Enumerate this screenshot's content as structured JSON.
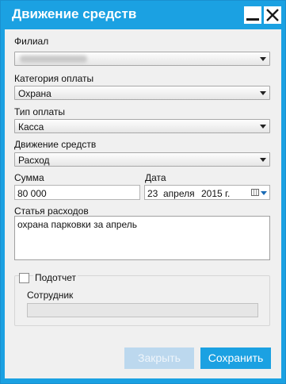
{
  "window": {
    "title": "Движение средств"
  },
  "fields": {
    "branch": {
      "label": "Филиал",
      "value": ""
    },
    "payment_category": {
      "label": "Категория оплаты",
      "value": "Охрана"
    },
    "payment_type": {
      "label": "Тип оплаты",
      "value": "Касса"
    },
    "cash_flow": {
      "label": "Движение средств",
      "value": "Расход"
    },
    "amount": {
      "label": "Сумма",
      "value": "80 000"
    },
    "date": {
      "label": "Дата",
      "day": "23",
      "month": "апреля",
      "year": "2015 г."
    },
    "expense_item": {
      "label": "Статья расходов",
      "value": "охрана парковки за апрель"
    },
    "accountable": {
      "label": "Подотчет",
      "checked": false
    },
    "employee": {
      "label": "Сотрудник",
      "value": ""
    }
  },
  "buttons": {
    "close": "Закрыть",
    "save": "Сохранить"
  },
  "colors": {
    "accent": "#1ba1e2",
    "disabled_button": "#bcd8ee"
  }
}
